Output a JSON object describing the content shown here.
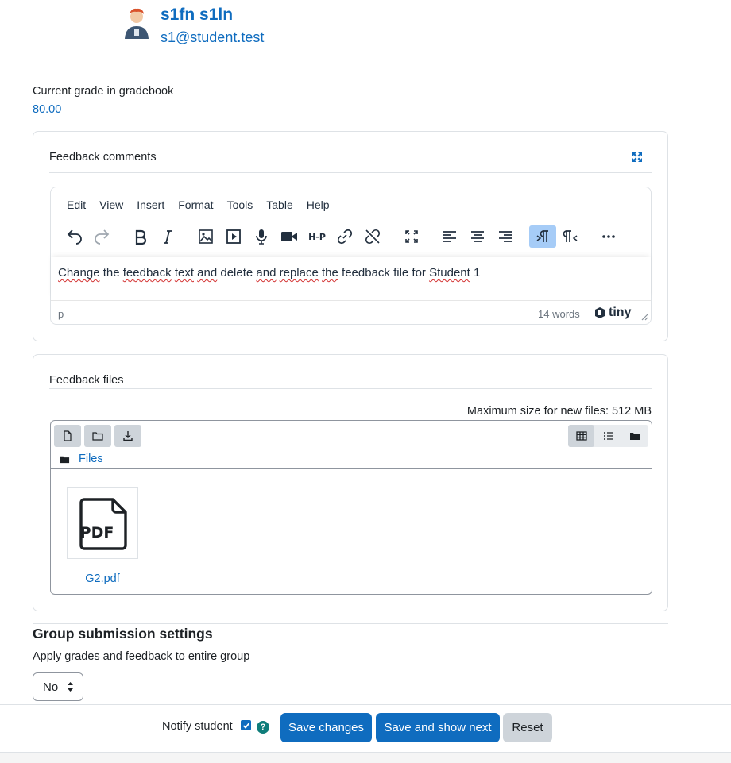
{
  "user": {
    "name": "s1fn s1ln",
    "email": "s1@student.test"
  },
  "grade": {
    "label": "Current grade in gradebook",
    "value": "80.00"
  },
  "feedback_comments": {
    "title": "Feedback comments",
    "menu": [
      "Edit",
      "View",
      "Insert",
      "Format",
      "Tools",
      "Table",
      "Help"
    ],
    "content_words": [
      "Change",
      "the",
      "feedback",
      "text",
      "and",
      "delete",
      "and",
      "replace",
      "the",
      "feedback file for",
      "Student",
      "1"
    ],
    "status_path": "p",
    "word_count": "14 words",
    "brand": "tiny"
  },
  "feedback_files": {
    "title": "Feedback files",
    "max_size": "Maximum size for new files: 512 MB",
    "breadcrumb": "Files",
    "files": [
      {
        "name": "G2.pdf",
        "icon_label": "PDF"
      }
    ]
  },
  "group_settings": {
    "title": "Group submission settings",
    "apply_label": "Apply grades and feedback to entire group",
    "select_value": "No"
  },
  "footer": {
    "notify_label": "Notify student",
    "notify_checked": true,
    "help_glyph": "?",
    "save_label": "Save changes",
    "save_next_label": "Save and show next",
    "reset_label": "Reset"
  },
  "colors": {
    "primary": "#0f6cbf",
    "secondary": "#ced4da",
    "active_tool": "#a6ccf7",
    "help": "#0f7d7a"
  }
}
